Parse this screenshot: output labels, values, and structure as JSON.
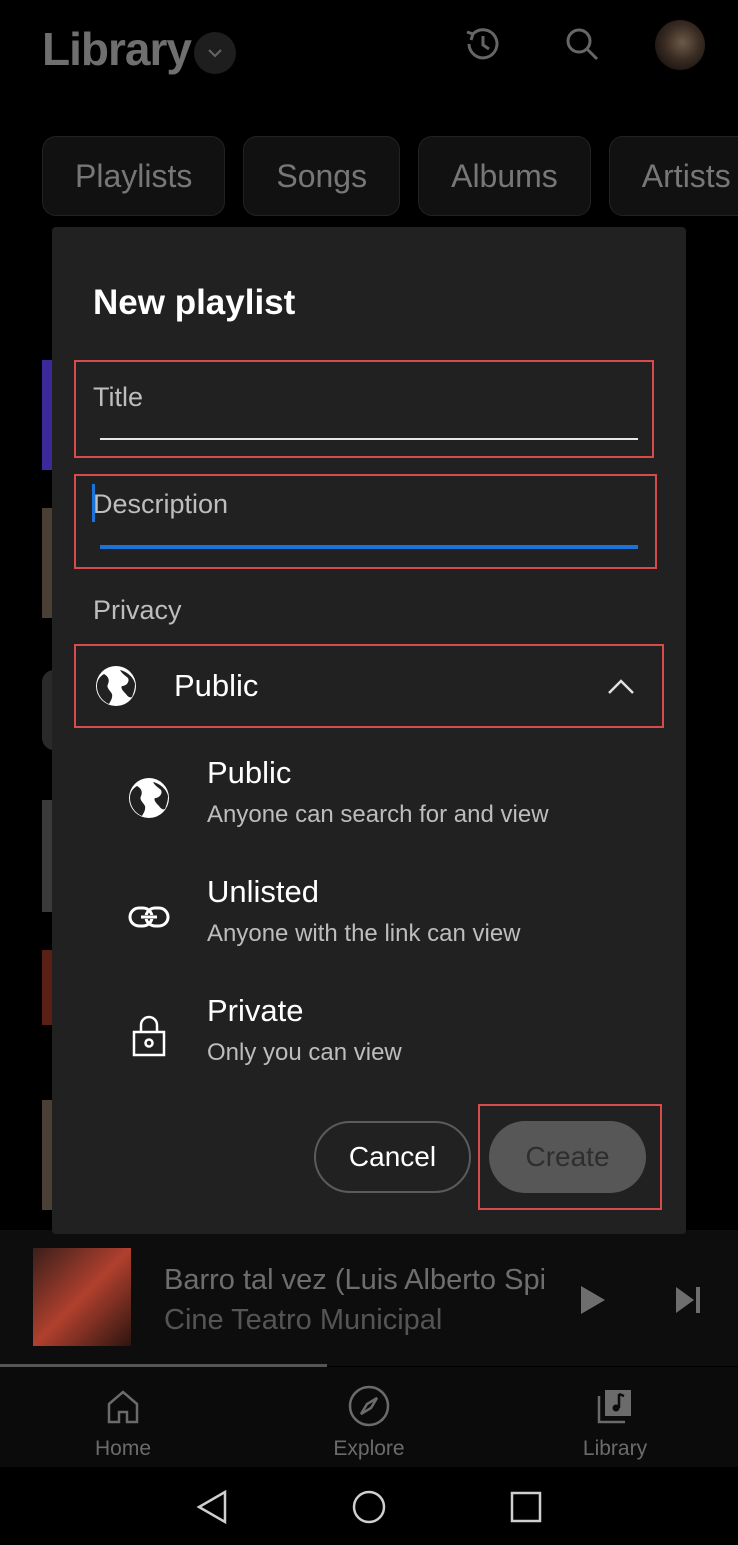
{
  "library": {
    "title": "Library",
    "chips": [
      "Playlists",
      "Songs",
      "Albums",
      "Artists"
    ]
  },
  "dialog": {
    "title": "New playlist",
    "title_field": {
      "placeholder": "Title",
      "value": ""
    },
    "description_field": {
      "placeholder": "Description",
      "value": ""
    },
    "privacy_label": "Privacy",
    "selected_privacy": "Public",
    "options": [
      {
        "name": "Public",
        "desc": "Anyone can search for and view",
        "icon": "globe-icon"
      },
      {
        "name": "Unlisted",
        "desc": "Anyone with the link can view",
        "icon": "link-icon"
      },
      {
        "name": "Private",
        "desc": "Only you can view",
        "icon": "lock-icon"
      }
    ],
    "cancel_label": "Cancel",
    "create_label": "Create"
  },
  "player": {
    "title": "Barro tal vez (Luis Alberto Spinetta)",
    "subtitle": "Cine Teatro Municipal"
  },
  "bottom_nav": [
    {
      "label": "Home",
      "icon": "home-icon"
    },
    {
      "label": "Explore",
      "icon": "compass-icon"
    },
    {
      "label": "Library",
      "icon": "library-icon"
    }
  ],
  "colors": {
    "highlight": "#d94a4a",
    "focus_accent": "#1a73d8",
    "dialog_bg": "#212121"
  }
}
